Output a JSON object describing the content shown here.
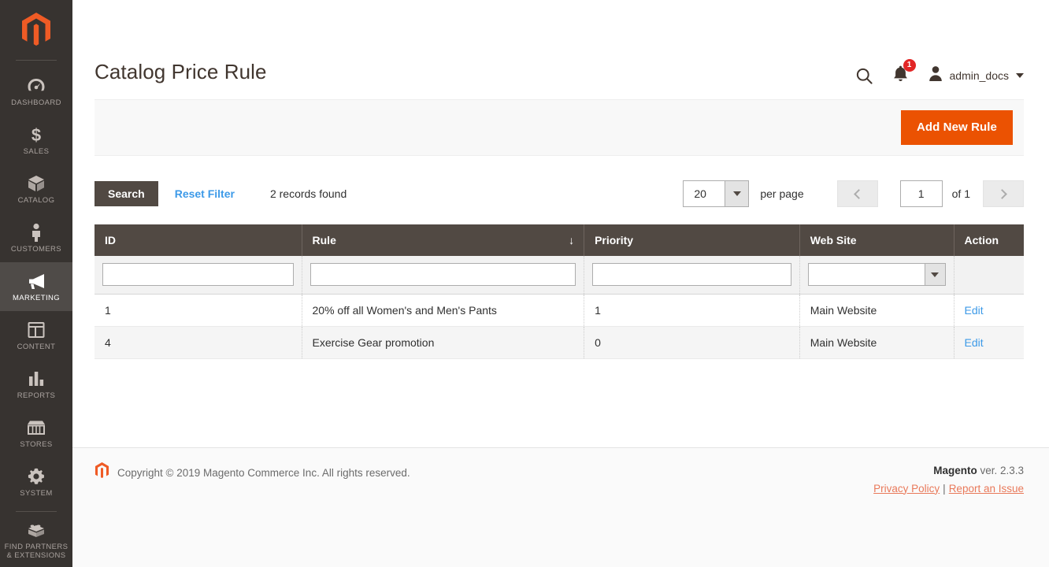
{
  "sidebar": {
    "logo": "magento-logo",
    "items": [
      {
        "label": "DASHBOARD",
        "icon": "gauge-icon",
        "active": false
      },
      {
        "label": "SALES",
        "icon": "dollar-icon",
        "active": false
      },
      {
        "label": "CATALOG",
        "icon": "box-icon",
        "active": false
      },
      {
        "label": "CUSTOMERS",
        "icon": "person-icon",
        "active": false
      },
      {
        "label": "MARKETING",
        "icon": "megaphone-icon",
        "active": true
      },
      {
        "label": "CONTENT",
        "icon": "layout-icon",
        "active": false
      },
      {
        "label": "REPORTS",
        "icon": "bar-chart-icon",
        "active": false
      },
      {
        "label": "STORES",
        "icon": "storefront-icon",
        "active": false
      },
      {
        "label": "SYSTEM",
        "icon": "gear-icon",
        "active": false
      },
      {
        "label": "FIND PARTNERS\n& EXTENSIONS",
        "icon": "brick-icon",
        "active": false
      }
    ]
  },
  "header": {
    "title": "Catalog Price Rule",
    "search_icon": "search-icon",
    "notifications_icon": "bell-icon",
    "notifications_count": "1",
    "user_icon": "user-avatar-icon",
    "user_name": "admin_docs"
  },
  "page_actions": {
    "add_new_rule_label": "Add New Rule"
  },
  "grid_toolbar": {
    "search_label": "Search",
    "reset_filter_label": "Reset Filter",
    "records_found": "2 records found",
    "per_page_value": "20",
    "per_page_label": "per page",
    "prev_icon": "chevron-left-icon",
    "next_icon": "chevron-right-icon",
    "page_value": "1",
    "of_label": "of 1"
  },
  "grid": {
    "columns": [
      {
        "label": "ID",
        "sort": ""
      },
      {
        "label": "Rule",
        "sort": "↓"
      },
      {
        "label": "Priority",
        "sort": ""
      },
      {
        "label": "Web Site",
        "sort": ""
      },
      {
        "label": "Action",
        "sort": ""
      }
    ],
    "filters": {
      "id": "",
      "rule": "",
      "priority": "",
      "website": ""
    },
    "rows": [
      {
        "id": "1",
        "rule": "20% off all Women's and Men's Pants",
        "priority": "1",
        "website": "Main Website",
        "action": "Edit"
      },
      {
        "id": "4",
        "rule": "Exercise Gear promotion",
        "priority": "0",
        "website": "Main Website",
        "action": "Edit"
      }
    ]
  },
  "footer": {
    "copyright": "Copyright © 2019 Magento Commerce Inc. All rights reserved.",
    "brand": "Magento",
    "version": " ver. 2.3.3",
    "privacy_policy": "Privacy Policy",
    "separator": "|",
    "report_issue": "Report an Issue"
  },
  "colors": {
    "accent_orange": "#eb5202",
    "sidebar_bg": "#373330",
    "header_bg": "#514943",
    "link_blue": "#3d9ae8",
    "badge_red": "#e22626"
  }
}
